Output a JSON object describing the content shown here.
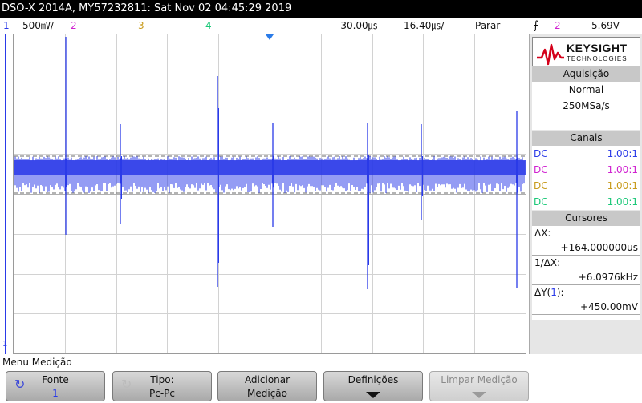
{
  "title": "DSO-X 2014A, MY57232811: Sat Nov 02 04:45:29 2019",
  "status": {
    "ch1_num": "1",
    "ch1_scale": "500㎷/",
    "ch2_num": "2",
    "ch3_num": "3",
    "ch4_num": "4",
    "delay": "-30.00㎲",
    "timebase": "16.40㎲/",
    "run_state": "Parar",
    "trigger_icon": "⨍",
    "trigger_source": "2",
    "trigger_level": "5.69V"
  },
  "colors": {
    "ch1": "#2a3ae8",
    "ch2": "#d020d0",
    "ch3": "#c89a1a",
    "ch4": "#1ac878"
  },
  "brand": {
    "name": "KEYSIGHT",
    "sub": "TECHNOLOGIES"
  },
  "acquisition": {
    "header": "Aquisição",
    "mode": "Normal",
    "rate": "250MSa/s"
  },
  "channels": {
    "header": "Canais",
    "rows": [
      {
        "coupling": "DC",
        "probe": "1.00:1"
      },
      {
        "coupling": "DC",
        "probe": "1.00:1"
      },
      {
        "coupling": "DC",
        "probe": "1.00:1"
      },
      {
        "coupling": "DC",
        "probe": "1.00:1"
      }
    ]
  },
  "cursors": {
    "header": "Cursores",
    "dx_label": "ΔX:",
    "dx_value": "+164.000000us",
    "inv_label": "1/ΔX:",
    "inv_value": "+6.0976kHz",
    "dy_label_pre": "ΔY(",
    "dy_label_ch": "1",
    "dy_label_post": "):",
    "dy_value": "+450.00mV"
  },
  "ground_marker": "1",
  "menu": {
    "title": "Menu Medição",
    "keys": [
      {
        "l1": "Fonte",
        "l2": "1"
      },
      {
        "l1": "Tipo:",
        "l2": "Pc-Pc"
      },
      {
        "l1": "Adicionar",
        "l2": "Medição"
      },
      {
        "l1": "Definições",
        "l2": ""
      },
      {
        "l1": "Limpar Medição",
        "l2": ""
      }
    ]
  }
}
